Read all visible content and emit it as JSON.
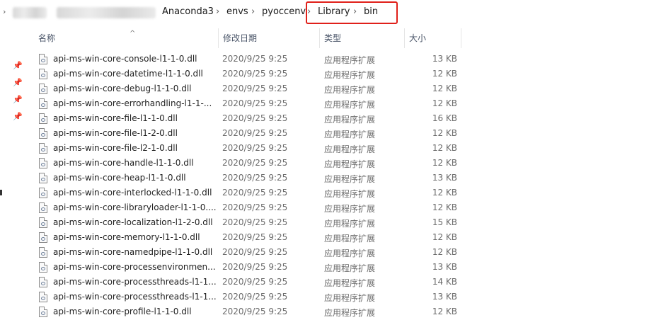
{
  "breadcrumb": {
    "segments": [
      "Anaconda3",
      "envs",
      "pyoccenv",
      "Library",
      "bin"
    ],
    "separator": "›",
    "highlight_color": "#e0201a"
  },
  "columns": {
    "name": "名称",
    "date": "修改日期",
    "type": "类型",
    "size": "大小"
  },
  "icons": {
    "pin": "pin-icon",
    "file": "dll-file-icon",
    "sort": "sort-ascending-icon"
  },
  "files": [
    {
      "name": "api-ms-win-core-console-l1-1-0.dll",
      "date": "2020/9/25 9:25",
      "type": "应用程序扩展",
      "size": "13 KB"
    },
    {
      "name": "api-ms-win-core-datetime-l1-1-0.dll",
      "date": "2020/9/25 9:25",
      "type": "应用程序扩展",
      "size": "12 KB"
    },
    {
      "name": "api-ms-win-core-debug-l1-1-0.dll",
      "date": "2020/9/25 9:25",
      "type": "应用程序扩展",
      "size": "12 KB"
    },
    {
      "name": "api-ms-win-core-errorhandling-l1-1-...",
      "date": "2020/9/25 9:25",
      "type": "应用程序扩展",
      "size": "12 KB"
    },
    {
      "name": "api-ms-win-core-file-l1-1-0.dll",
      "date": "2020/9/25 9:25",
      "type": "应用程序扩展",
      "size": "16 KB"
    },
    {
      "name": "api-ms-win-core-file-l1-2-0.dll",
      "date": "2020/9/25 9:25",
      "type": "应用程序扩展",
      "size": "12 KB"
    },
    {
      "name": "api-ms-win-core-file-l2-1-0.dll",
      "date": "2020/9/25 9:25",
      "type": "应用程序扩展",
      "size": "12 KB"
    },
    {
      "name": "api-ms-win-core-handle-l1-1-0.dll",
      "date": "2020/9/25 9:25",
      "type": "应用程序扩展",
      "size": "12 KB"
    },
    {
      "name": "api-ms-win-core-heap-l1-1-0.dll",
      "date": "2020/9/25 9:25",
      "type": "应用程序扩展",
      "size": "13 KB"
    },
    {
      "name": "api-ms-win-core-interlocked-l1-1-0.dll",
      "date": "2020/9/25 9:25",
      "type": "应用程序扩展",
      "size": "12 KB"
    },
    {
      "name": "api-ms-win-core-libraryloader-l1-1-0....",
      "date": "2020/9/25 9:25",
      "type": "应用程序扩展",
      "size": "12 KB"
    },
    {
      "name": "api-ms-win-core-localization-l1-2-0.dll",
      "date": "2020/9/25 9:25",
      "type": "应用程序扩展",
      "size": "15 KB"
    },
    {
      "name": "api-ms-win-core-memory-l1-1-0.dll",
      "date": "2020/9/25 9:25",
      "type": "应用程序扩展",
      "size": "12 KB"
    },
    {
      "name": "api-ms-win-core-namedpipe-l1-1-0.dll",
      "date": "2020/9/25 9:25",
      "type": "应用程序扩展",
      "size": "12 KB"
    },
    {
      "name": "api-ms-win-core-processenvironmen...",
      "date": "2020/9/25 9:25",
      "type": "应用程序扩展",
      "size": "13 KB"
    },
    {
      "name": "api-ms-win-core-processthreads-l1-1...",
      "date": "2020/9/25 9:25",
      "type": "应用程序扩展",
      "size": "14 KB"
    },
    {
      "name": "api-ms-win-core-processthreads-l1-1...",
      "date": "2020/9/25 9:25",
      "type": "应用程序扩展",
      "size": "13 KB"
    },
    {
      "name": "api-ms-win-core-profile-l1-1-0.dll",
      "date": "2020/9/25 9:25",
      "type": "应用程序扩展",
      "size": "12 KB"
    }
  ]
}
